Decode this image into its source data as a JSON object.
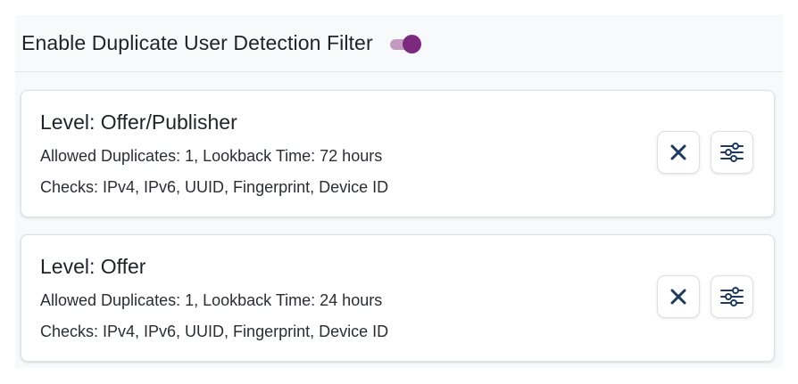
{
  "header": {
    "title": "Enable Duplicate User Detection Filter",
    "toggle_on": true
  },
  "colors": {
    "accent": "#7b2a7f",
    "accent_track": "#c49ac2",
    "icon": "#1f3a5f"
  },
  "rules": [
    {
      "level": "Level: Offer/Publisher",
      "details": "Allowed Duplicates: 1, Lookback Time: 72 hours",
      "checks": "Checks: IPv4, IPv6, UUID, Fingerprint, Device ID",
      "remove_icon": "close-icon",
      "settings_icon": "sliders-icon"
    },
    {
      "level": "Level: Offer",
      "details": "Allowed Duplicates: 1, Lookback Time: 24 hours",
      "checks": "Checks: IPv4, IPv6, UUID, Fingerprint, Device ID",
      "remove_icon": "close-icon",
      "settings_icon": "sliders-icon"
    }
  ]
}
